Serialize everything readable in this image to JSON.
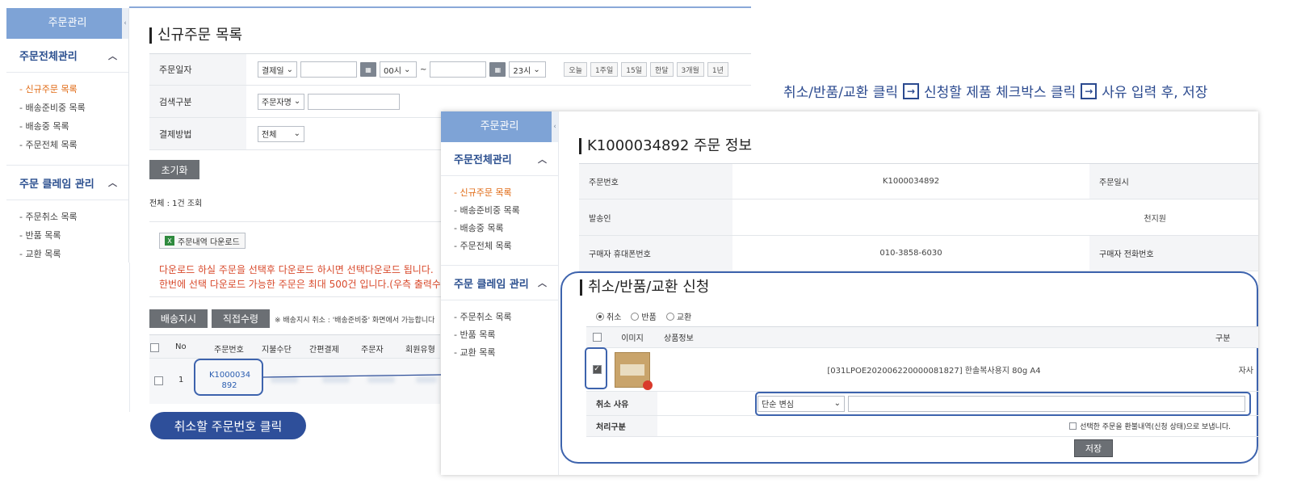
{
  "sidebar": {
    "header": "주문관리",
    "collapse_glyph": "‹",
    "sections": [
      {
        "title": "주문전체관리",
        "items": [
          "- 신규주문 목록",
          "- 배송준비중 목록",
          "- 배송중 목록",
          "- 주문전체 목록"
        ]
      },
      {
        "title": "주문 클레임 관리",
        "items": [
          "- 주문취소 목록",
          "- 반품 목록",
          "- 교환 목록"
        ]
      }
    ],
    "active_item": "- 신규주문 목록"
  },
  "main": {
    "title": "신규주문 목록",
    "filters": {
      "order_date_label": "주문일자",
      "date_type": "결제일",
      "start_hour": "00시",
      "tilde": "~",
      "end_hour": "23시",
      "quick_ranges": [
        "오늘",
        "1주일",
        "15일",
        "한달",
        "3개월",
        "1년"
      ],
      "search_label": "검색구분",
      "search_type": "주문자명",
      "payment_label": "결제방법",
      "payment_value": "전체"
    },
    "reset_button": "초기화",
    "total_text": "전체 : 1건 조회",
    "download_button": "주문내역 다운로드",
    "notice_line1": "다운로드 하실 주문을 선택후 다운로드 하시면 선택다운로드 됩니다.",
    "notice_line2": "한번에 선택 다운로드 가능한 주문은 최대 500건 입니다.(우측 출력수 조정",
    "ship_button": "배송지시",
    "direct_button": "직접수령",
    "ship_note": "※ 배송지시 취소 : '배송준비중' 화면에서 가능합니다",
    "columns": [
      "No",
      "주문번호",
      "지불수단",
      "간편결제",
      "주문자",
      "회원유형"
    ],
    "row": {
      "no": "1",
      "order_no_line1": "K1000034",
      "order_no_line2": "892"
    }
  },
  "callout_pill": "취소할 주문번호 클릭",
  "instruction": {
    "step1": "취소/반품/교환 클릭",
    "step2": "신청할 제품 체크박스 클릭",
    "step3": "사유 입력 후, 저장",
    "arrow_glyph": "→"
  },
  "detail": {
    "sidebar_header": "주문관리",
    "title": "K1000034892 주문 정보",
    "rows": [
      {
        "label": "주문번호",
        "value": "K1000034892",
        "label2": "주문일시"
      },
      {
        "label": "발송인",
        "value": "천지원",
        "label2": ""
      },
      {
        "label": "구매자 휴대폰번호",
        "value": "010-3858-6030",
        "label2": "구매자 전화번호"
      }
    ],
    "claim": {
      "title": "취소/반품/교환 신청",
      "radios": [
        "취소",
        "반품",
        "교환"
      ],
      "selected_radio": "취소",
      "col_image": "이미지",
      "col_product": "상품정보",
      "col_type": "구분",
      "product": "[031LPOE202006220000081827] 한솔복사용지 80g A4",
      "product_type": "자사",
      "reason_label": "취소 사유",
      "reason_value": "단순 변심",
      "process_label": "처리구분",
      "process_text": "선택한 주문을 환불내역(신청 상태)으로 보냅니다.",
      "save_button": "저장"
    }
  },
  "colors": {
    "accent_blue": "#3d63ad",
    "sidebar_header": "#7ea3d6",
    "active_orange": "#e06a14",
    "notice_red": "#d8492b"
  }
}
